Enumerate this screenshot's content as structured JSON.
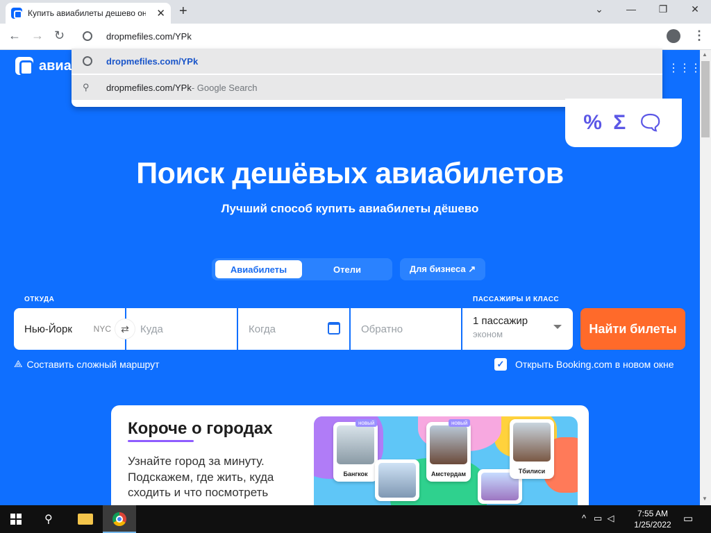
{
  "browser": {
    "tab_title": "Купить авиабилеты дешево онлайн",
    "url": "dropmefiles.com/YPk",
    "suggestions": [
      {
        "text": "dropmefiles.com/YPk",
        "suffix": ""
      },
      {
        "text": "dropmefiles.com/YPk",
        "suffix": " - Google Search"
      }
    ]
  },
  "site": {
    "logo_text": "авиа",
    "promo_icons": [
      "percent-icon",
      "sigma-icon",
      "chat-icon"
    ],
    "heading": "Поиск дешёвых авиабилетов",
    "subheading": "Лучший способ купить авиабилеты дёшево",
    "tabs": [
      {
        "label": "Авиабилеты",
        "active": true
      },
      {
        "label": "Отели",
        "active": false
      }
    ],
    "business_label": "Для бизнеса ↗"
  },
  "search": {
    "from_label": "ОТКУДА",
    "from_value": "Нью-Йорк",
    "from_code": "NYC",
    "to_placeholder": "Куда",
    "when_placeholder": "Когда",
    "back_placeholder": "Обратно",
    "pax_label": "ПАССАЖИРЫ И КЛАСС",
    "pax_count": "1 пассажир",
    "pax_class": "эконом",
    "find_button": "Найти билеты",
    "complex_route": "Составить сложный маршрут",
    "booking_checkbox": "Открыть Booking.com в новом окне",
    "booking_checked": true
  },
  "card": {
    "title": "Короче о городах",
    "text": "Узнайте город за минуту. Подскажем, где жить, куда сходить и что посмотреть",
    "cities": [
      {
        "name": "Бангкок",
        "badge": "новый"
      },
      {
        "name": "Амстердам",
        "badge": "новый"
      },
      {
        "name": "Тбилиси",
        "badge": ""
      }
    ]
  },
  "taskbar": {
    "time": "7:55 AM",
    "date": "1/25/2022"
  },
  "colors": {
    "brand_blue": "#0f6fff",
    "cta_orange": "#ff6a2a",
    "accent_purple": "#8e5cff"
  }
}
